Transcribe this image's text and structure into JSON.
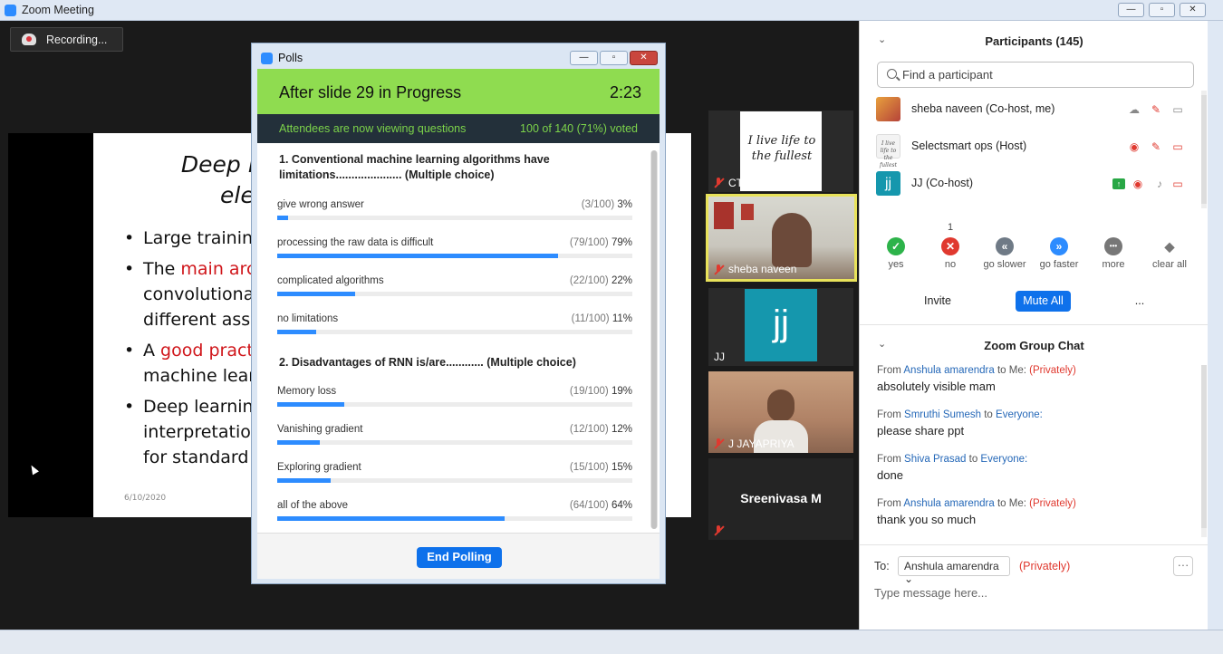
{
  "window": {
    "title": "Zoom Meeting",
    "min": "—",
    "max": "▫",
    "close": "✕"
  },
  "recording": {
    "label": "Recording..."
  },
  "slide": {
    "heading_line1": "Deep le",
    "heading_line2": "ele",
    "bullets": [
      {
        "parts": [
          "Large trainin"
        ]
      },
      {
        "parts": [
          "The ",
          "main arc"
        ],
        "line2": "convolutiona",
        "line3": "different ass"
      },
      {
        "parts": [
          "A ",
          "good pract"
        ],
        "line2": "machine lear"
      },
      {
        "parts": [
          "Deep learnin"
        ],
        "line2": "interpretatio",
        "line3": "for standard"
      }
    ],
    "date": "6/10/2020"
  },
  "polls": {
    "title": "Polls",
    "header_title": "After slide 29  in Progress",
    "timer": "2:23",
    "status_left": "Attendees are now viewing questions",
    "status_right": "100 of 140 (71%) voted",
    "questions": [
      {
        "title": "1. Conventional machine learning algorithms have limitations..................... (Multiple choice)",
        "options": [
          {
            "label": "give wrong answer",
            "count": "(3/100)",
            "pct": "3%",
            "value": 3
          },
          {
            "label": "processing the raw data is difficult",
            "count": "(79/100)",
            "pct": "79%",
            "value": 79
          },
          {
            "label": "complicated algorithms",
            "count": "(22/100)",
            "pct": "22%",
            "value": 22
          },
          {
            "label": "no limitations",
            "count": "(11/100)",
            "pct": "11%",
            "value": 11
          }
        ]
      },
      {
        "title": "2. Disadvantages of RNN is/are............ (Multiple choice)",
        "options": [
          {
            "label": "Memory loss",
            "count": "(19/100)",
            "pct": "19%",
            "value": 19
          },
          {
            "label": "Vanishing gradient",
            "count": "(12/100)",
            "pct": "12%",
            "value": 12
          },
          {
            "label": "Exploring gradient",
            "count": "(15/100)",
            "pct": "15%",
            "value": 15
          },
          {
            "label": "all of the above",
            "count": "(64/100)",
            "pct": "64%",
            "value": 64
          }
        ]
      }
    ],
    "end_button": "End Polling"
  },
  "videos": {
    "tile1": {
      "name": "CTDS",
      "image_text": "I live life to the fullest"
    },
    "tile2": {
      "name": "sheba naveen"
    },
    "tile3": {
      "name": "JJ",
      "avatar_text": "jj"
    },
    "tile4": {
      "name": "J JAYAPRIYA"
    },
    "tile5": {
      "name": "Sreenivasa M"
    }
  },
  "participants": {
    "header": "Participants (145)",
    "search_placeholder": "Find a participant",
    "list": [
      {
        "name": "sheba naveen (Co-host, me)",
        "avatar": ""
      },
      {
        "name": "Selectsmart ops (Host)",
        "avatar": "I live life to the fullest"
      },
      {
        "name": "JJ (Co-host)",
        "avatar": "jj"
      }
    ],
    "reactions": [
      {
        "label": "yes",
        "count": "",
        "icon": "✓"
      },
      {
        "label": "no",
        "count": "1",
        "icon": "✕"
      },
      {
        "label": "go slower",
        "count": "",
        "icon": "«"
      },
      {
        "label": "go faster",
        "count": "",
        "icon": "»"
      },
      {
        "label": "more",
        "count": "",
        "icon": "•••"
      },
      {
        "label": "clear all",
        "count": "",
        "icon": "◆"
      }
    ],
    "invite": "Invite",
    "mute_all": "Mute All",
    "more": "..."
  },
  "chat": {
    "header": "Zoom Group Chat",
    "messages": [
      {
        "from": "From ",
        "sender": "Anshula amarendra",
        "to": " to Me: ",
        "privately": "(Privately)",
        "text": "absolutely visible mam"
      },
      {
        "from": "From ",
        "sender": "Smruthi Sumesh",
        "to": " to ",
        "recipient": "Everyone:",
        "text": "please share ppt"
      },
      {
        "from": "From ",
        "sender": "Shiva Prasad",
        "to": " to ",
        "recipient": "Everyone:",
        "text": "done"
      },
      {
        "from": "From ",
        "sender": "Anshula amarendra",
        "to": " to Me: ",
        "privately": "(Privately)",
        "text": "thank you so much"
      }
    ],
    "to_label": "To:",
    "to_value": "Anshula amarendra",
    "to_privately": "(Privately)",
    "input_placeholder": "Type message here..."
  },
  "colors": {
    "accent": "#2d8cff",
    "poll_header": "#8fdc50",
    "private": "#e0392f"
  }
}
